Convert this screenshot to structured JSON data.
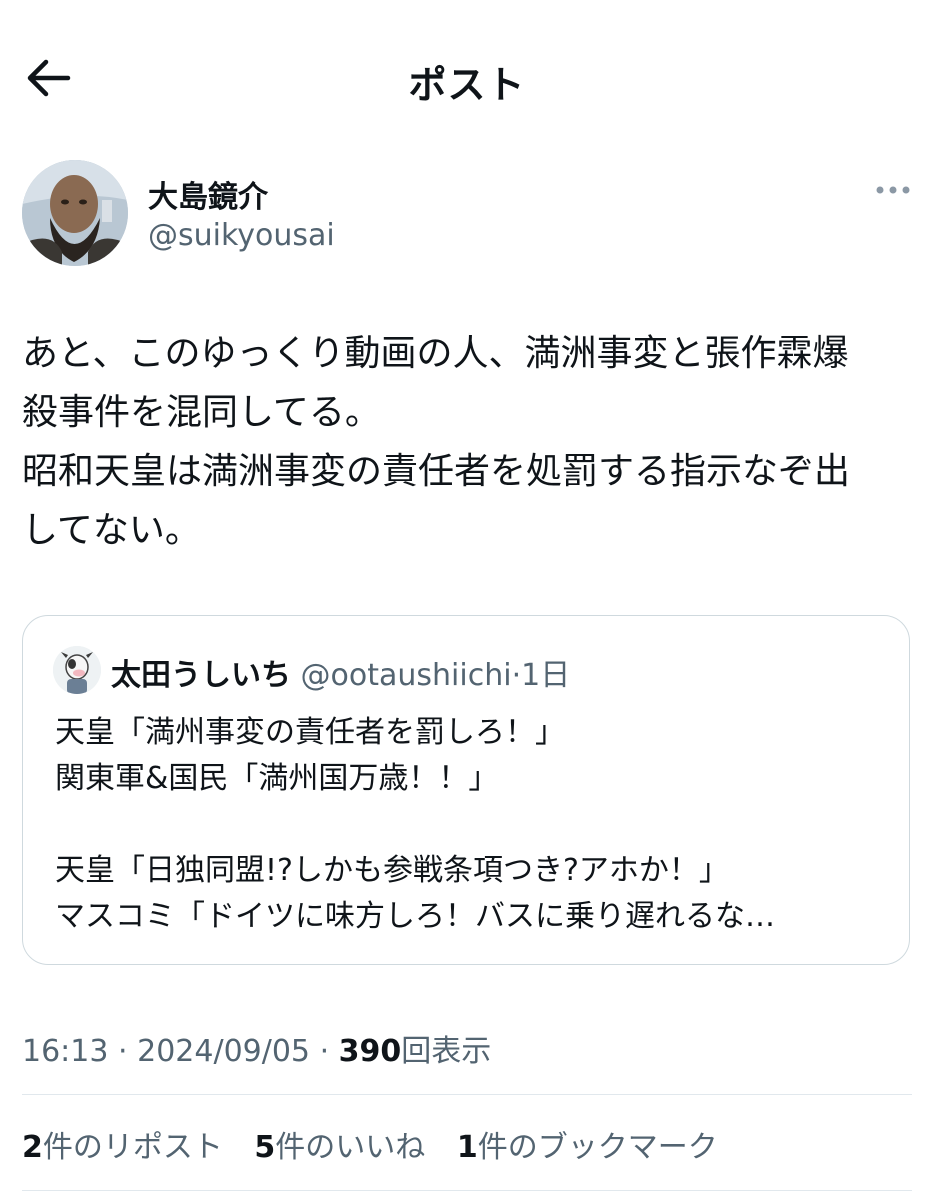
{
  "header": {
    "back_icon": "arrow-left-icon",
    "title": "ポスト"
  },
  "author": {
    "name": "大島鏡介",
    "handle": "@suikyousai",
    "more_icon": "more-horizontal-icon"
  },
  "post": {
    "lines": [
      "あと、このゆっくり動画の人、満洲事変と張作霖爆",
      "殺事件を混同してる。",
      "昭和天皇は満洲事変の責任者を処罰する指示なぞ出",
      "してない。"
    ]
  },
  "quote": {
    "name": "太田うしいち",
    "handle": "@ootaushiichi",
    "separator": "·",
    "time": "1日",
    "lines": [
      "天皇「満州事変の責任者を罰しろ！」",
      "関東軍&国民「満州国万歳！！」",
      "",
      "天皇「日独同盟!?しかも参戦条項つき?アホか！」",
      "マスコミ「ドイツに味方しろ！バスに乗り遅れるな…"
    ]
  },
  "meta": {
    "time": "16:13",
    "date": "2024/09/05",
    "separator": "·",
    "views_count": "390",
    "views_label": "回表示"
  },
  "stats": {
    "reposts_count": "2",
    "reposts_label": "件のリポスト",
    "likes_count": "5",
    "likes_label": "件のいいね",
    "bookmarks_count": "1",
    "bookmarks_label": "件のブックマーク"
  },
  "colors": {
    "text": "#0f1419",
    "secondary": "#536471",
    "border": "#cfd9de"
  }
}
